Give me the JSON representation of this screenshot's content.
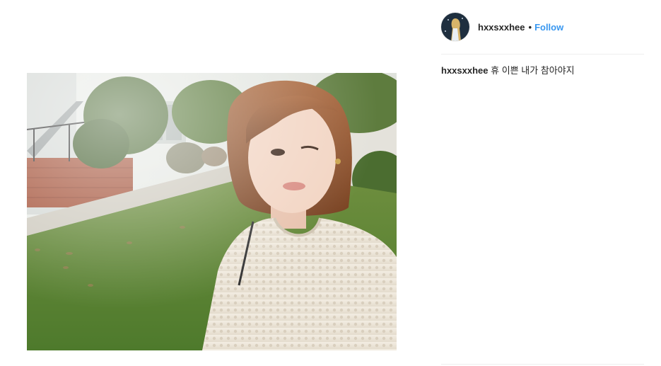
{
  "post": {
    "username": "hxxsxxhee",
    "separator": "•",
    "follow_label": "Follow",
    "caption": {
      "username": "hxxsxxhee",
      "text": "휴 이쁜 내가 참아야지"
    }
  },
  "icons": {
    "avatar": "profile-photo",
    "photo": "selfie-photo"
  },
  "colors": {
    "link": "#3897f0",
    "text": "#262626",
    "divider": "#efefef"
  }
}
